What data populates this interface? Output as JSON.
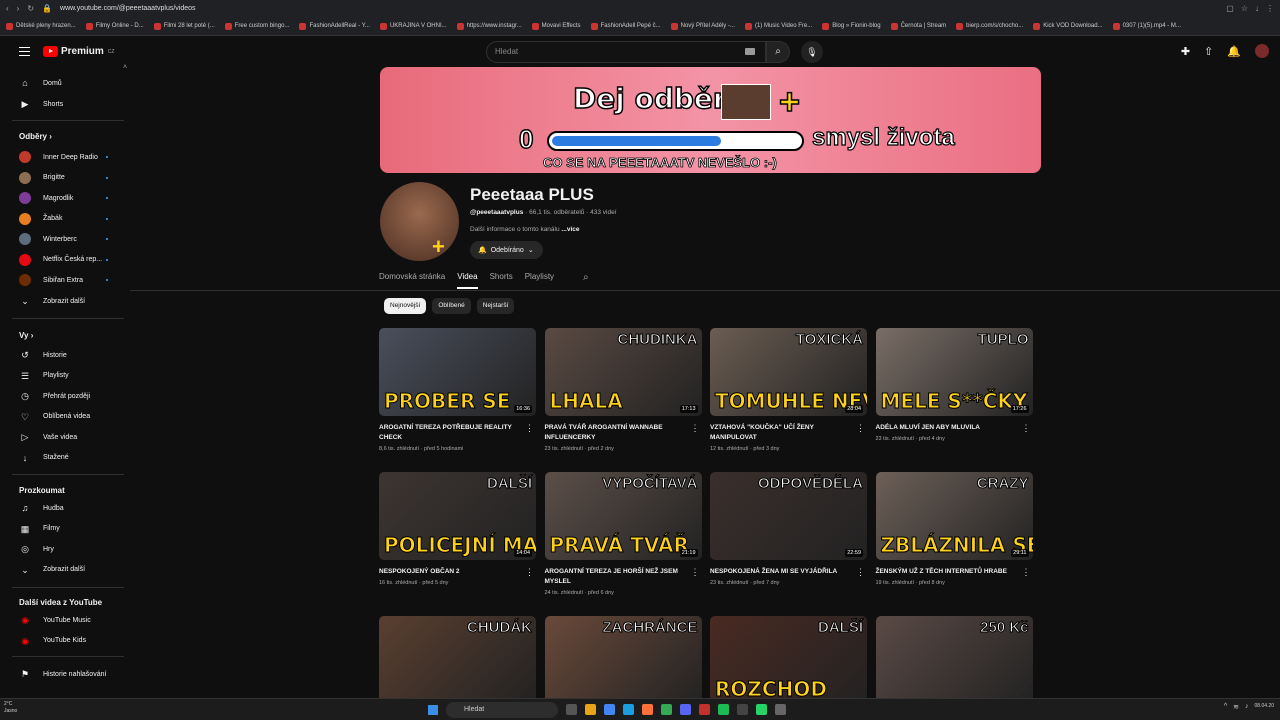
{
  "browser": {
    "url": "www.youtube.com/@peeetaaatvplus/videos"
  },
  "bookmarks": [
    "Dětské pleny hrazen...",
    "Filmy Online - D...",
    "Filmi 28 let poté (...",
    "Free custom bingo...",
    "FashionAdellReal - Y...",
    "UKRAJINA V OHNI...",
    "https://www.instagr...",
    "Movavi Effects",
    "FashionAdell Pepé č...",
    "Nový Přítel Adély -...",
    "(1) Music Video Fre...",
    "Blog » Fionin-blog",
    "Černota | Stream",
    "bierp.com/s/chocho...",
    "Kick VOD Download...",
    "0307 (1)(5).mp4 - M..."
  ],
  "header": {
    "logo_text": "Premium",
    "logo_sup": "CZ",
    "search_placeholder": "Hledat"
  },
  "sidebar": {
    "main": [
      {
        "label": "Domů",
        "icon": "home-icon"
      },
      {
        "label": "Shorts",
        "icon": "shorts-icon"
      }
    ],
    "subs_title": "Odběry",
    "subs": [
      {
        "label": "Inner Deep Radio",
        "color": "#c0392b"
      },
      {
        "label": "Brigitte",
        "color": "#8e6e53"
      },
      {
        "label": "Magrodlik",
        "color": "#7d3c98"
      },
      {
        "label": "Žabák",
        "color": "#e67e22"
      },
      {
        "label": "Winterberc",
        "color": "#5d6d7e"
      },
      {
        "label": "Netflix Česká rep...",
        "color": "#e50914"
      },
      {
        "label": "Sibiřan Extra",
        "color": "#6e2c00"
      }
    ],
    "subs_more": "Zobrazit další",
    "you_title": "Vy",
    "you": [
      {
        "label": "Historie",
        "icon": "history-icon"
      },
      {
        "label": "Playlisty",
        "icon": "playlist-icon"
      },
      {
        "label": "Přehrát později",
        "icon": "watch-later-icon"
      },
      {
        "label": "Oblíbená videa",
        "icon": "like-icon"
      },
      {
        "label": "Vaše videa",
        "icon": "your-videos-icon"
      },
      {
        "label": "Stažené",
        "icon": "download-icon"
      }
    ],
    "explore_title": "Prozkoumat",
    "explore": [
      {
        "label": "Hudba",
        "icon": "music-icon"
      },
      {
        "label": "Filmy",
        "icon": "film-icon"
      },
      {
        "label": "Hry",
        "icon": "gaming-icon"
      },
      {
        "label": "Zobrazit další",
        "icon": "chevron-down-icon"
      }
    ],
    "more_title": "Další videa z YouTube",
    "more": [
      {
        "label": "YouTube Music",
        "icon": "yt-music-icon"
      },
      {
        "label": "YouTube Kids",
        "icon": "yt-kids-icon"
      }
    ],
    "report": "Historie nahlašování"
  },
  "banner": {
    "line1": "Dej odběr",
    "zero": "0",
    "line2": "smysl života",
    "line3": "CO SE NA PEEETAAATV NEVEŠLO :-)",
    "progress": 0.68
  },
  "channel": {
    "name": "Peeetaaa PLUS",
    "handle": "@peeetaaatvplus",
    "meta": " · 66,1 tis. odběratelů · 433 videí",
    "more_prefix": "Další informace o tomto kanálu ",
    "more_link": "...více",
    "subscribe_label": "Odebíráno"
  },
  "tabs": [
    "Domovská stránka",
    "Videa",
    "Shorts",
    "Playlisty"
  ],
  "active_tab": 1,
  "chips": [
    "Nejnovější",
    "Oblíbené",
    "Nejstarší"
  ],
  "videos": [
    {
      "title": "AROGATNÍ TEREZA POTŘEBUJE REALITY CHECK",
      "meta": "8,6 tis. zhlédnutí · před 5 hodinami",
      "duration": "16:36",
      "thumb_text": "PROBER SE",
      "thumb_top": "",
      "bg": "#4a4f5c"
    },
    {
      "title": "PRAVÁ TVÁŘ AROGANTNÍ WANNABE INFLUENCERKY",
      "meta": "23 tis. zhlédnutí · před 2 dny",
      "duration": "17:13",
      "thumb_text": "LHALA",
      "thumb_top": "CHUDINKA",
      "bg": "#5a4a42"
    },
    {
      "title": "VZTAHOVÁ \"KOUČKA\" UČÍ ŽENY MANIPULOVAT",
      "meta": "12 tis. zhlédnutí · před 3 dny",
      "duration": "28:04",
      "thumb_text": "TOMUHLE NEVĚŘTE",
      "thumb_top": "TOXICKÁ",
      "bg": "#6b5d52"
    },
    {
      "title": "ADÉLA MLUVÍ JEN ABY MLUVILA",
      "meta": "23 tis. zhlédnutí · před 4 dny",
      "duration": "17:26",
      "thumb_text": "MELE S**ČKY",
      "thumb_top": "TUPLO",
      "bg": "#7a6e66"
    },
    {
      "title": "NESPOKOJENÝ OBČAN 2",
      "meta": "16 tis. zhlédnutí · před 5 dny",
      "duration": "14:04",
      "thumb_text": "POLICEJNÍ MAFIE",
      "thumb_top": "DALŠÍ",
      "bg": "#3d3532"
    },
    {
      "title": "AROGANTNÍ TEREZA JE HORŠÍ NEŽ JSEM MYSLEL",
      "meta": "24 tis. zhlédnutí · před 6 dny",
      "duration": "21:19",
      "thumb_text": "PRAVÁ TVÁŘ",
      "thumb_top": "VYPOČÍTAVÁ",
      "bg": "#5c4f48"
    },
    {
      "title": "NESPOKOJENÁ ŽENA MI SE VYJÁDŘILA",
      "meta": "23 tis. zhlédnutí · před 7 dny",
      "duration": "22:59",
      "thumb_text": "",
      "thumb_top": "ODPOVĚDĚLA",
      "bg": "#3a2f2c"
    },
    {
      "title": "ŽENSKÝM UŽ Z TĚCH INTERNETŮ HRABE",
      "meta": "19 tis. zhlédnutí · před 8 dny",
      "duration": "29:11",
      "thumb_text": "ZBLÁZNILA SE",
      "thumb_top": "CRAZY",
      "bg": "#6d6058"
    },
    {
      "title": "",
      "meta": "",
      "duration": "",
      "thumb_text": "",
      "thumb_top": "CHUDÁK",
      "bg": "#5a3f30"
    },
    {
      "title": "",
      "meta": "",
      "duration": "",
      "thumb_text": "",
      "thumb_top": "ZACHRÁNCE",
      "bg": "#6a4a3a"
    },
    {
      "title": "",
      "meta": "",
      "duration": "",
      "thumb_text": "ROZCHOD",
      "thumb_top": "DALŠÍ",
      "bg": "#4a2a22"
    },
    {
      "title": "",
      "meta": "",
      "duration": "",
      "thumb_text": "",
      "thumb_top": "250 Kč",
      "bg": "#5a4a45"
    }
  ],
  "taskbar": {
    "weather": "2°C",
    "weather2": "Jasno",
    "search": "Hledat",
    "clock": "08.04.20"
  }
}
